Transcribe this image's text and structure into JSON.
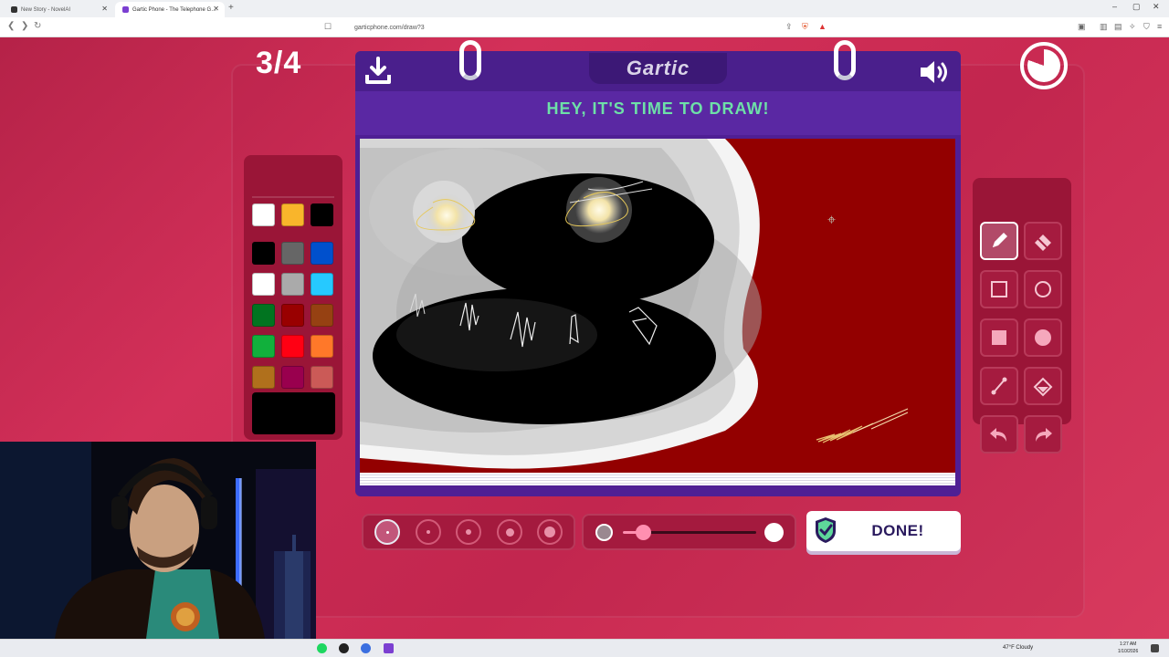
{
  "browser": {
    "tabs": [
      {
        "title": "New Story - NovelAI",
        "active": false
      },
      {
        "title": "Gartic Phone - The Telephone G…",
        "active": true
      }
    ],
    "new_tab_symbol": "+",
    "url": "garticphone.com/draw?3",
    "window_controls": [
      "–",
      "▢",
      "✕"
    ]
  },
  "game": {
    "round": "3/4",
    "logo": "Gartic",
    "headline": "HEY, IT'S TIME TO DRAW!",
    "done_label": "DONE!",
    "colors": {
      "accent_purple": "#5a28a3",
      "headline_green": "#6ee0a8",
      "canvas_background": "#930000"
    },
    "palette_top": [
      "#ffffff",
      "#f9b52b",
      "#000000"
    ],
    "palette_grid": [
      "#000000",
      "#666666",
      "#0050cd",
      "#ffffff",
      "#aaaaaa",
      "#26c9ff",
      "#017420",
      "#990000",
      "#964112",
      "#11b03c",
      "#ff0013",
      "#ff7829",
      "#b0701c",
      "#99004e",
      "#cb5a57",
      "#ffc126",
      "#ff008f",
      "#feafa8"
    ],
    "selected_color": "#000000",
    "tools": [
      {
        "name": "pencil",
        "icon": "pencil-icon",
        "active": true
      },
      {
        "name": "eraser",
        "icon": "eraser-icon",
        "active": false
      },
      {
        "name": "rectangle-outline",
        "icon": "square-outline-icon",
        "active": false
      },
      {
        "name": "ellipse-outline",
        "icon": "circle-outline-icon",
        "active": false
      },
      {
        "name": "rectangle-fill",
        "icon": "square-filled-icon",
        "active": false
      },
      {
        "name": "ellipse-fill",
        "icon": "circle-filled-icon",
        "active": false
      },
      {
        "name": "line",
        "icon": "line-icon",
        "active": false
      },
      {
        "name": "fill-bucket",
        "icon": "bucket-icon",
        "active": false
      },
      {
        "name": "undo",
        "icon": "undo-icon",
        "active": false
      },
      {
        "name": "redo",
        "icon": "redo-icon",
        "active": false
      }
    ],
    "brush_sizes": {
      "count": 5,
      "selected_index": 0
    },
    "opacity_level": 0.15
  },
  "taskbar": {
    "weather": "47°F  Cloudy",
    "time": "1:27 AM",
    "date": "1/10/2026"
  }
}
